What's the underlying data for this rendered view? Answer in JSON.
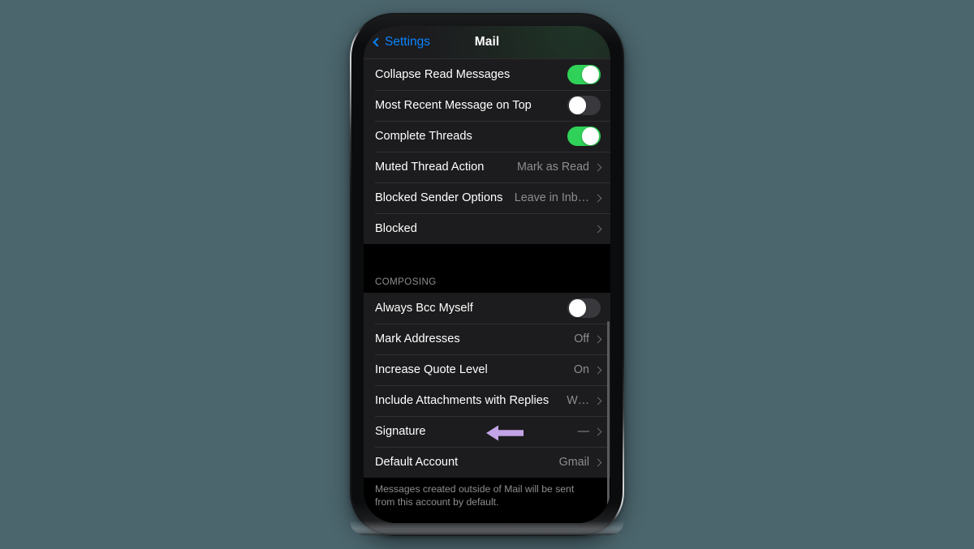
{
  "theme": {
    "page_background": "#4C666E",
    "screen_background": "#000000",
    "row_background": "#1C1C1E",
    "accent_blue": "#0A84FF",
    "toggle_on": "#30D158",
    "toggle_off": "#39393D",
    "secondary_text": "#8E8E93",
    "annotation_arrow_color": "#C3A4E6"
  },
  "navbar": {
    "back_label": "Settings",
    "back_icon": "chevron-left-icon",
    "title": "Mail"
  },
  "groups": [
    {
      "header": "",
      "rows": [
        {
          "label": "Collapse Read Messages",
          "control": "toggle",
          "toggle_state": "on"
        },
        {
          "label": "Most Recent Message on Top",
          "control": "toggle",
          "toggle_state": "off"
        },
        {
          "label": "Complete Threads",
          "control": "toggle",
          "toggle_state": "on"
        },
        {
          "label": "Muted Thread Action",
          "control": "disclosure",
          "value": "Mark as Read"
        },
        {
          "label": "Blocked Sender Options",
          "control": "disclosure",
          "value": "Leave in Inb…"
        },
        {
          "label": "Blocked",
          "control": "disclosure",
          "value": ""
        }
      ],
      "footer": ""
    },
    {
      "header": "COMPOSING",
      "rows": [
        {
          "label": "Always Bcc Myself",
          "control": "toggle",
          "toggle_state": "off"
        },
        {
          "label": "Mark Addresses",
          "control": "disclosure",
          "value": "Off"
        },
        {
          "label": "Increase Quote Level",
          "control": "disclosure",
          "value": "On"
        },
        {
          "label": "Include Attachments with Replies",
          "control": "disclosure",
          "value": "W…"
        },
        {
          "label": "Signature",
          "control": "disclosure",
          "value": "—"
        },
        {
          "label": "Default Account",
          "control": "disclosure",
          "value": "Gmail"
        }
      ],
      "footer": "Messages created outside of Mail will be sent from this account by default."
    }
  ],
  "annotation": {
    "icon": "arrow-left-icon",
    "points_at": "Signature",
    "color": "#C3A4E6"
  }
}
